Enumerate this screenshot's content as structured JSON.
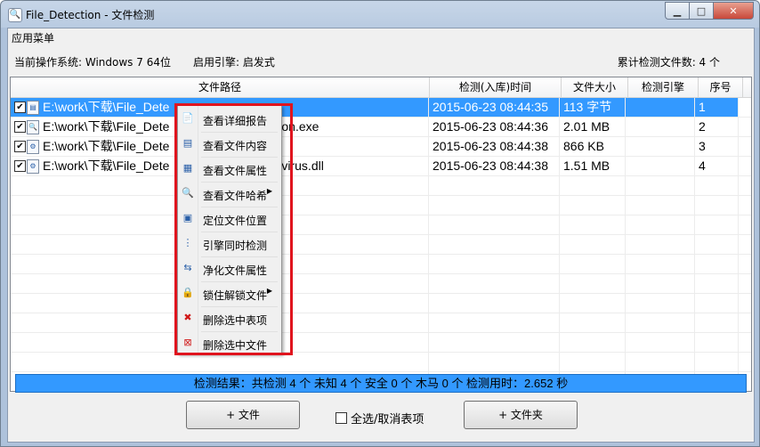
{
  "window": {
    "title": "File_Detection - 文件检测",
    "app_icon": "magnifier-icon",
    "buttons": {
      "minimize": "▁",
      "maximize": "□",
      "close": "✕"
    }
  },
  "menu": {
    "app_menu": "应用菜单"
  },
  "info": {
    "os": "当前操作系统: Windows 7 64位",
    "engine": "启用引擎: 启发式",
    "count": "累计检测文件数: 4 个"
  },
  "table": {
    "headers": [
      "文件路径",
      "检测(入库)时间",
      "文件大小",
      "检测引擎",
      "序号"
    ],
    "rows": [
      {
        "path": "E:\\work\\下载\\File_Dete",
        "path_tail": "",
        "time": "2015-06-23 08:44:35",
        "size": "113 字节",
        "engine": "",
        "num": "1",
        "checked": true,
        "selected": true
      },
      {
        "path": "E:\\work\\下载\\File_Dete",
        "path_tail": "on.exe",
        "time": "2015-06-23 08:44:36",
        "size": "2.01 MB",
        "engine": "",
        "num": "2",
        "checked": true,
        "selected": false
      },
      {
        "path": "E:\\work\\下载\\File_Dete",
        "path_tail": "",
        "time": "2015-06-23 08:44:38",
        "size": "866 KB",
        "engine": "",
        "num": "3",
        "checked": true,
        "selected": false
      },
      {
        "path": "E:\\work\\下载\\File_Dete",
        "path_tail": "virus.dll",
        "time": "2015-06-23 08:44:38",
        "size": "1.51 MB",
        "engine": "",
        "num": "4",
        "checked": true,
        "selected": false
      }
    ]
  },
  "context_menu": {
    "items": [
      {
        "label": "查看详细报告",
        "icon": "report-icon",
        "submenu": false
      },
      {
        "label": "查看文件内容",
        "icon": "document-icon",
        "submenu": false
      },
      {
        "label": "查看文件属性",
        "icon": "properties-icon",
        "submenu": false
      },
      {
        "label": "查看文件哈希",
        "icon": "magnifier-icon",
        "submenu": true
      },
      {
        "label": "定位文件位置",
        "icon": "locate-icon",
        "submenu": false
      },
      {
        "label": "引擎同时检测",
        "icon": "engines-icon",
        "submenu": false
      },
      {
        "label": "净化文件属性",
        "icon": "clean-icon",
        "submenu": false
      },
      {
        "label": "锁住解锁文件",
        "icon": "lock-icon",
        "submenu": true
      },
      {
        "label": "删除选中表项",
        "icon": "delete-item-icon",
        "submenu": false
      },
      {
        "label": "删除选中文件",
        "icon": "delete-file-icon",
        "submenu": false
      }
    ]
  },
  "status": {
    "text": "检测结果：共检测 4 个   未知 4 个   安全 0 个   木马 0 个     检测用时：2.652 秒"
  },
  "buttons": {
    "add_file": "+ 文件",
    "select_all": "全选/取消表项",
    "add_folder": "+ 文件夹"
  },
  "colors": {
    "selection": "#3399ff",
    "highlight_box": "#e0141e"
  }
}
